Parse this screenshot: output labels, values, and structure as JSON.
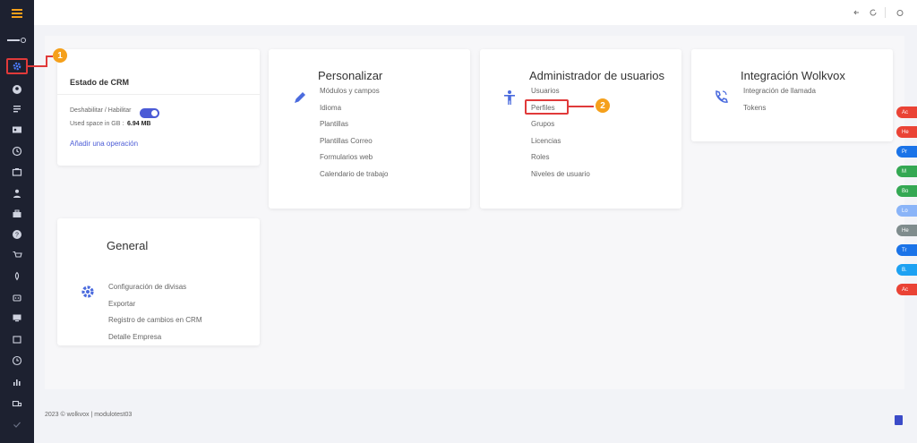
{
  "topbar": {
    "icons": [
      "back-icon",
      "refresh-icon",
      "power-icon"
    ]
  },
  "sidebar": {
    "items": [
      "gear-icon",
      "user-circle-icon",
      "list-icon",
      "id-card-icon",
      "clock-icon",
      "briefcase-icon",
      "person-icon",
      "case-icon",
      "help-icon",
      "cart-icon",
      "rocket-icon",
      "robot-icon",
      "monitor-icon",
      "store-icon",
      "history-icon",
      "bar-chart-icon",
      "truck-icon",
      "check-icon"
    ]
  },
  "crm_card": {
    "title": "Estado de CRM",
    "toggle_label": "Deshabilitar / Habilitar",
    "toggle_on": true,
    "space_label": "Used space in GB :",
    "space_value": "6.94 MB",
    "add_operation": "Añadir una operación"
  },
  "personalizar": {
    "title": "Personalizar",
    "links": [
      "Módulos y campos",
      "Idioma",
      "Plantillas",
      "Plantillas Correo",
      "Formularios web",
      "Calendario de trabajo"
    ]
  },
  "usuarios": {
    "title": "Administrador de usuarios",
    "links": [
      "Usuarios",
      "Perfiles",
      "Grupos",
      "Licencias",
      "Roles",
      "Niveles de usuario"
    ]
  },
  "integracion": {
    "title": "Integración Wolkvox",
    "links": [
      "Integración de llamada",
      "Tokens"
    ]
  },
  "general": {
    "title": "General",
    "links": [
      "Configuración de divisas",
      "Exportar",
      "Registro de cambios en CRM",
      "Detalle Empresa"
    ]
  },
  "annotations": {
    "step1": "1",
    "step2": "2"
  },
  "floating_buttons": [
    {
      "label": "Ac",
      "color": "#ea4335"
    },
    {
      "label": "He",
      "color": "#ea4335"
    },
    {
      "label": "Pr",
      "color": "#1a73e8"
    },
    {
      "label": "M",
      "color": "#34a853"
    },
    {
      "label": "Bo",
      "color": "#34a853"
    },
    {
      "label": "Lo",
      "color": "#8ab4f8"
    },
    {
      "label": "He",
      "color": "#7f8c8d"
    },
    {
      "label": "Tr",
      "color": "#1a73e8"
    },
    {
      "label": "B.",
      "color": "#1da1f2"
    },
    {
      "label": "Ac",
      "color": "#ea4335"
    }
  ],
  "footer": {
    "text": "2023 © wolkvox | modulotest03"
  },
  "colors": {
    "sidebar": "#1d2130",
    "accent": "#4b5bd6",
    "annotation": "#e03a3a",
    "badge": "#f5a01b"
  }
}
